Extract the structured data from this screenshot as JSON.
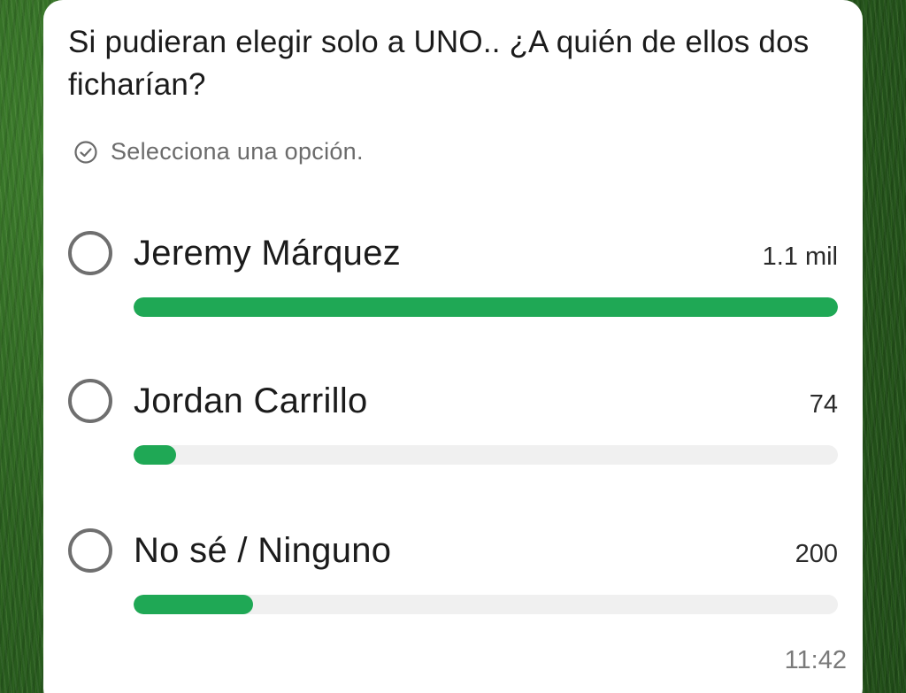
{
  "poll": {
    "question": "Si pudieran elegir solo a UNO.. ¿A quién de ellos dos ficharían?",
    "hint_icon": "check-circle-icon",
    "hint": "Selecciona una opción.",
    "accent_color": "#1fa855",
    "track_color": "#f0f0f0",
    "options": [
      {
        "label": "Jeremy Márquez",
        "count": "1.1 mil",
        "fill_fraction": 1.0
      },
      {
        "label": "Jordan Carrillo",
        "count": "74",
        "fill_fraction": 0.06
      },
      {
        "label": "No sé / Ninguno",
        "count": "200",
        "fill_fraction": 0.17
      }
    ],
    "time": "11:42"
  }
}
